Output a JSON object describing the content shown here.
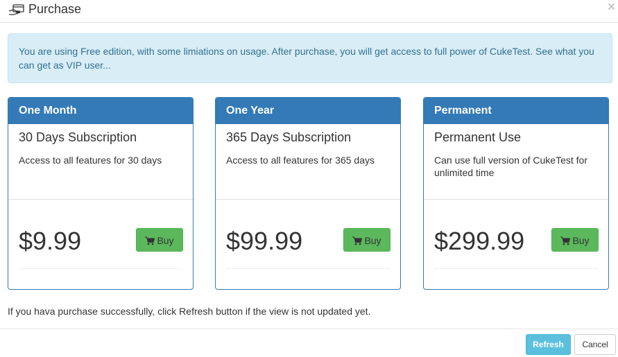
{
  "dialog": {
    "title": "Purchase",
    "title_icon": "hand-card-icon",
    "close_label": "×"
  },
  "alert": {
    "text": "You are using Free edition, with some limiations on usage. After purchase, you will get access to full power of CukeTest. ",
    "link_text": "See what you can get as VIP user..."
  },
  "plans": [
    {
      "header": "One Month",
      "subtitle": "30 Days Subscription",
      "description": "Access to all features for 30 days",
      "price": "$9.99",
      "buy_label": "Buy"
    },
    {
      "header": "One Year",
      "subtitle": "365 Days Subscription",
      "description": "Access to all features for 365 days",
      "price": "$99.99",
      "buy_label": "Buy"
    },
    {
      "header": "Permanent",
      "subtitle": "Permanent Use",
      "description": "Can use full version of CukeTest for unlimited time",
      "price": "$299.99",
      "buy_label": "Buy"
    }
  ],
  "note": "If you hava purchase successfully, click Refresh button if the view is not updated yet.",
  "footer": {
    "refresh_label": "Refresh",
    "cancel_label": "Cancel"
  },
  "colors": {
    "primary": "#337ab7",
    "success": "#5cb85c",
    "info": "#5bc0de",
    "alert_bg": "#d9edf7"
  }
}
